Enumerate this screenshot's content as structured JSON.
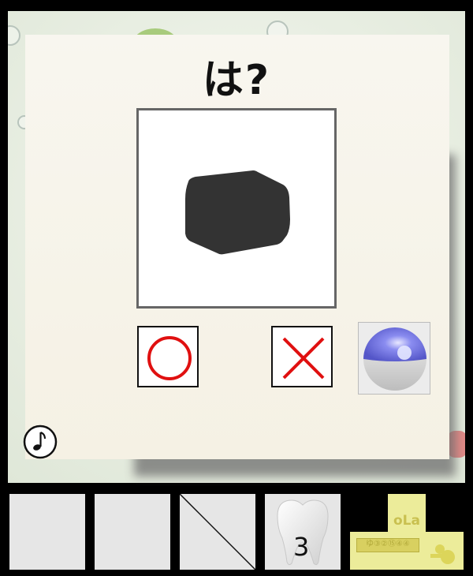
{
  "question": {
    "text": "は?"
  },
  "answer_buttons": {
    "correct_symbol": "circle-icon",
    "wrong_symbol": "cross-icon",
    "accent_red": "#e01010"
  },
  "options": {
    "orb": "crystal-ball-icon",
    "music": "music-note-icon"
  },
  "inventory": {
    "slots": [
      {
        "item": ""
      },
      {
        "item": ""
      },
      {
        "item": "diagonal-line"
      },
      {
        "item": "tooth",
        "count": "3"
      },
      {
        "item": "logo-plate",
        "text": "oLa",
        "sub": "ゆ③②⑮④④"
      }
    ]
  },
  "colors": {
    "dialog": "#f6f3e8",
    "slot": "#e6e6e6",
    "frame": "#666666"
  }
}
